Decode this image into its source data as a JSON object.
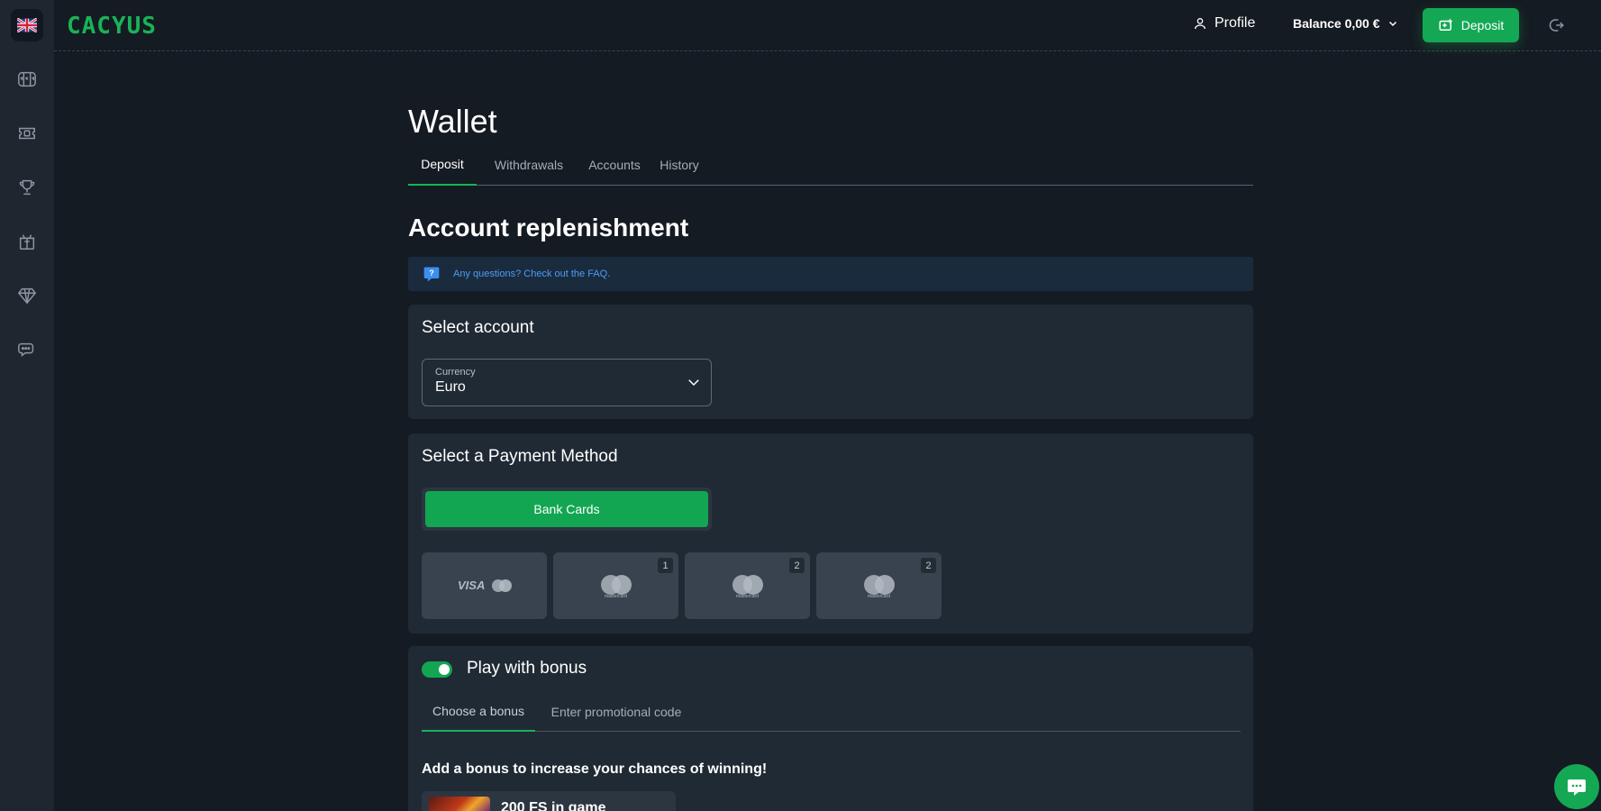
{
  "colors": {
    "accent": "#18b357",
    "background": "#151b22",
    "panel": "#202a34",
    "link": "#4e9cf3"
  },
  "sidebar": {
    "flag_icon": "uk-flag-icon",
    "items": [
      {
        "icon": "slot-machine-icon"
      },
      {
        "icon": "ticket-icon"
      },
      {
        "icon": "trophy-icon"
      },
      {
        "icon": "gift-box-icon"
      },
      {
        "icon": "diamond-icon"
      },
      {
        "icon": "chat-bubbles-icon"
      }
    ]
  },
  "header": {
    "logo": "CACYUS",
    "profile_label": "Profile",
    "balance_label": "Balance 0,00 €",
    "deposit_label": "Deposit"
  },
  "page": {
    "title": "Wallet",
    "tabs": [
      {
        "label": "Deposit",
        "active": true
      },
      {
        "label": "Withdrawals",
        "active": false
      },
      {
        "label": "Accounts",
        "active": false
      },
      {
        "label": "History",
        "active": false
      }
    ]
  },
  "replenishment": {
    "title": "Account replenishment",
    "faq_text": "Any questions? Check out the FAQ."
  },
  "select_account": {
    "title": "Select account",
    "currency_label": "Currency",
    "currency_value": "Euro"
  },
  "payment": {
    "title": "Select a Payment Method",
    "method_label": "Bank Cards",
    "cards": [
      {
        "type": "visa-mastercard",
        "visa_text": "VISA",
        "badge": ""
      },
      {
        "type": "mastercard",
        "text": "mastercard",
        "badge": "1"
      },
      {
        "type": "mastercard",
        "text": "mastercard",
        "badge": "2"
      },
      {
        "type": "mastercard",
        "text": "mastercard",
        "badge": "2"
      }
    ]
  },
  "bonus": {
    "toggle_on": true,
    "title": "Play with bonus",
    "tabs": [
      {
        "label": "Choose a bonus",
        "active": true
      },
      {
        "label": "Enter promotional code",
        "active": false
      }
    ],
    "description": "Add a bonus to increase your chances of winning!",
    "items": [
      {
        "name": "200 FS in game"
      }
    ]
  }
}
